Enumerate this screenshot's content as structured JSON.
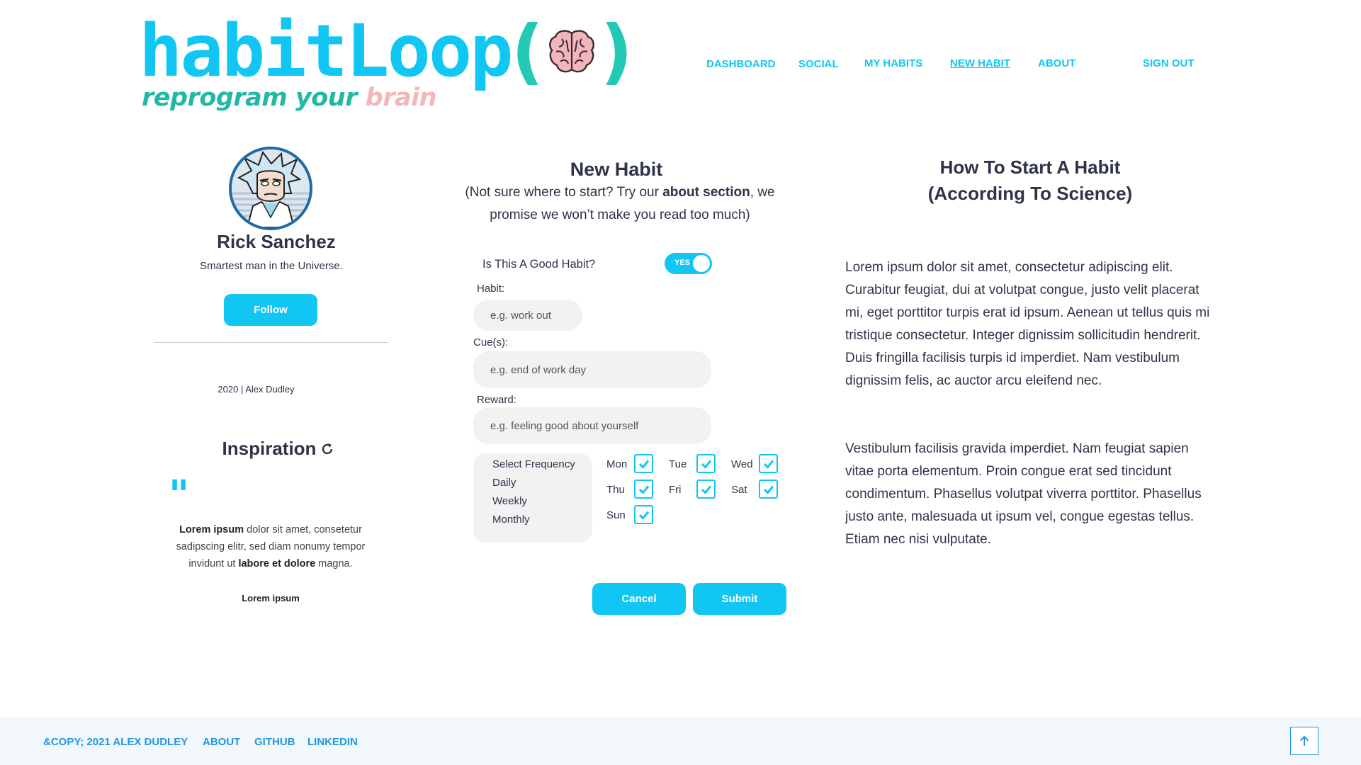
{
  "brand": {
    "name": "habitLoop",
    "paren_open": "(",
    "paren_close": ")",
    "tagline_a": "reprogram your",
    "tagline_b": "brain",
    "logo_icon": "brain-icon"
  },
  "nav": {
    "items": [
      {
        "label": "DASHBOARD"
      },
      {
        "label": "SOCIAL"
      },
      {
        "label": "MY HABITS"
      },
      {
        "label": "NEW HABIT",
        "active": true
      },
      {
        "label": "ABOUT"
      },
      {
        "label": "SIGN OUT"
      }
    ]
  },
  "profile": {
    "name": "Rick Sanchez",
    "bio": "Smartest man in the Universe.",
    "follow_label": "Follow",
    "credit": "2020 | Alex Dudley"
  },
  "inspiration": {
    "title": "Inspiration",
    "refresh_icon": "refresh-icon",
    "quote_mark": "\"",
    "quote_b1": "Lorem ipsum",
    "quote_t1": " dolor sit amet, consetetur sadipscing elitr, sed diam nonumy tempor invidunt ut ",
    "quote_b2": "labore et dolore",
    "quote_t2": " magna.",
    "author": "Lorem ipsum"
  },
  "form": {
    "title": "New Habit",
    "sub_pre": "(Not sure where to start? Try our ",
    "sub_bold": "about section",
    "sub_post": ", we promise we won’t make you read too much)",
    "good_habit_label": "Is This A Good Habit?",
    "toggle_text": "YES",
    "toggle_on": true,
    "habit_label": "Habit:",
    "habit_placeholder": "e.g. work out",
    "cue_label": "Cue(s):",
    "cue_placeholder": "e.g. end of work day",
    "reward_label": "Reward:",
    "reward_placeholder": "e.g. feeling good about yourself",
    "frequency_options": [
      "Select Frequency",
      "Daily",
      "Weekly",
      "Monthly"
    ],
    "days": [
      {
        "label": "Mon",
        "checked": true
      },
      {
        "label": "Tue",
        "checked": true
      },
      {
        "label": "Wed",
        "checked": true
      },
      {
        "label": "Thu",
        "checked": true
      },
      {
        "label": "Fri",
        "checked": true
      },
      {
        "label": "Sat",
        "checked": true
      },
      {
        "label": "Sun",
        "checked": true
      }
    ],
    "cancel_label": "Cancel",
    "submit_label": "Submit"
  },
  "science": {
    "title_line1": "How To Start A Habit",
    "title_line2": "(According To Science)",
    "para1": "Lorem ipsum dolor sit amet, consectetur adipiscing elit. Curabitur feugiat, dui at volutpat congue, justo velit placerat mi, eget porttitor turpis erat id ipsum. Aenean ut tellus quis mi tristique consectetur. Integer dignissim sollicitudin hendrerit. Duis fringilla facilisis turpis id imperdiet. Nam vestibulum dignissim felis, ac auctor arcu eleifend nec.",
    "para2": "Vestibulum facilisis gravida imperdiet. Nam feugiat sapien vitae porta elementum. Proin congue erat sed tincidunt condimentum. Phasellus volutpat viverra porttitor. Phasellus justo ante, malesuada ut ipsum vel, congue egestas tellus. Etiam nec nisi vulputate."
  },
  "footer": {
    "copyright": "&COPY; 2021 ALEX DUDLEY",
    "about": "ABOUT",
    "github": "GITHUB",
    "linkedin": "LINKEDIN",
    "top_icon": "arrow-up-icon"
  },
  "colors": {
    "accent": "#12c6f3",
    "teal": "#23c9b4",
    "pink": "#f4b7b8",
    "footer_link": "#2196e3",
    "text": "#2f3348"
  }
}
